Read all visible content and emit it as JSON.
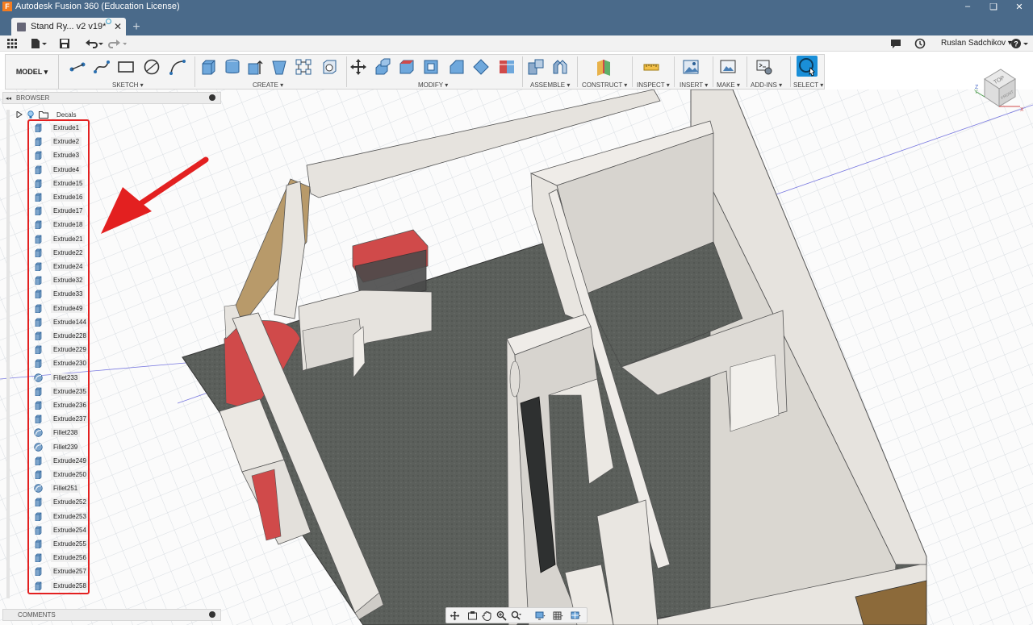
{
  "window": {
    "title": "Autodesk Fusion 360 (Education License)",
    "app_letter": "F",
    "minimize": "–",
    "maximize": "❏",
    "close": "✕"
  },
  "tabs": {
    "document_tab": "Stand Ry... v2 v19*",
    "close_glyph": "✕",
    "new_tab_glyph": "+"
  },
  "quick_access": {
    "user_name": "Ruslan Sadchikov ▾",
    "help_glyph": "?",
    "icons": [
      "grid-menu-icon",
      "file-icon",
      "save-icon",
      "undo-icon",
      "redo-icon",
      "notifications-icon",
      "job-status-icon",
      "help-icon"
    ]
  },
  "ribbon": {
    "workspace": "MODEL ▾",
    "groups": [
      {
        "label": "SKETCH ▾"
      },
      {
        "label": "CREATE ▾"
      },
      {
        "label": "MODIFY ▾"
      },
      {
        "label": "ASSEMBLE ▾"
      },
      {
        "label": "CONSTRUCT ▾"
      },
      {
        "label": "INSPECT ▾"
      },
      {
        "label": "INSERT ▾"
      },
      {
        "label": "MAKE ▾"
      },
      {
        "label": "ADD-INS ▾"
      },
      {
        "label": "SELECT ▾"
      }
    ]
  },
  "viewcube": {
    "top_label": "TOP",
    "front_label": "FRONT",
    "axis_x": "X",
    "axis_y": "Y",
    "axis_z": "Z"
  },
  "browser": {
    "header": "BROWSER",
    "collapse_glyph": "◂◂",
    "decals_label": "Decals",
    "items": [
      {
        "label": "Extrude1",
        "type": "extrude"
      },
      {
        "label": "Extrude2",
        "type": "extrude"
      },
      {
        "label": "Extrude3",
        "type": "extrude"
      },
      {
        "label": "Extrude4",
        "type": "extrude"
      },
      {
        "label": "Extrude15",
        "type": "extrude"
      },
      {
        "label": "Extrude16",
        "type": "extrude"
      },
      {
        "label": "Extrude17",
        "type": "extrude"
      },
      {
        "label": "Extrude18",
        "type": "extrude"
      },
      {
        "label": "Extrude21",
        "type": "extrude"
      },
      {
        "label": "Extrude22",
        "type": "extrude"
      },
      {
        "label": "Extrude24",
        "type": "extrude"
      },
      {
        "label": "Extrude32",
        "type": "extrude"
      },
      {
        "label": "Extrude33",
        "type": "extrude"
      },
      {
        "label": "Extrude49",
        "type": "extrude"
      },
      {
        "label": "Extrude144",
        "type": "extrude"
      },
      {
        "label": "Extrude228",
        "type": "extrude"
      },
      {
        "label": "Extrude229",
        "type": "extrude"
      },
      {
        "label": "Extrude230",
        "type": "extrude"
      },
      {
        "label": "Fillet233",
        "type": "fillet"
      },
      {
        "label": "Extrude235",
        "type": "extrude"
      },
      {
        "label": "Extrude236",
        "type": "extrude"
      },
      {
        "label": "Extrude237",
        "type": "extrude"
      },
      {
        "label": "Fillet238",
        "type": "fillet"
      },
      {
        "label": "Fillet239",
        "type": "fillet"
      },
      {
        "label": "Extrude249",
        "type": "extrude"
      },
      {
        "label": "Extrude250",
        "type": "extrude"
      },
      {
        "label": "Fillet251",
        "type": "fillet"
      },
      {
        "label": "Extrude252",
        "type": "extrude"
      },
      {
        "label": "Extrude253",
        "type": "extrude"
      },
      {
        "label": "Extrude254",
        "type": "extrude"
      },
      {
        "label": "Extrude255",
        "type": "extrude"
      },
      {
        "label": "Extrude256",
        "type": "extrude"
      },
      {
        "label": "Extrude257",
        "type": "extrude"
      },
      {
        "label": "Extrude258",
        "type": "extrude"
      }
    ]
  },
  "comments": {
    "label": "COMMENTS"
  },
  "colors": {
    "title_bar": "#4a6a8a",
    "highlight_red": "#e32020",
    "arrow_red": "#e32020",
    "floor": "#5a5e5a",
    "wall": "#e4e1dc",
    "counter_red": "#d04a4a",
    "wood": "#b89a6a",
    "select_blue": "#1a8fd8"
  }
}
